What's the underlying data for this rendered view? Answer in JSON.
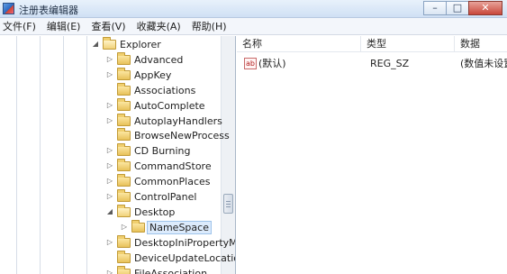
{
  "window": {
    "title": "注册表编辑器",
    "minimize_glyph": "–",
    "maximize_glyph": "□",
    "close_glyph": "✕"
  },
  "menu": [
    "文件(F)",
    "编辑(E)",
    "查看(V)",
    "收藏夹(A)",
    "帮助(H)"
  ],
  "tree": {
    "items": [
      {
        "label": "Explorer",
        "depth": 0,
        "state": "expanded",
        "folder_icon": "folder-open-icon"
      },
      {
        "label": "Advanced",
        "depth": 1,
        "state": "collapsed",
        "folder_icon": "folder-icon"
      },
      {
        "label": "AppKey",
        "depth": 1,
        "state": "collapsed",
        "folder_icon": "folder-icon"
      },
      {
        "label": "Associations",
        "depth": 1,
        "state": "none",
        "folder_icon": "folder-icon"
      },
      {
        "label": "AutoComplete",
        "depth": 1,
        "state": "collapsed",
        "folder_icon": "folder-icon"
      },
      {
        "label": "AutoplayHandlers",
        "depth": 1,
        "state": "collapsed",
        "folder_icon": "folder-icon"
      },
      {
        "label": "BrowseNewProcess",
        "depth": 1,
        "state": "none",
        "folder_icon": "folder-icon"
      },
      {
        "label": "CD Burning",
        "depth": 1,
        "state": "collapsed",
        "folder_icon": "folder-icon"
      },
      {
        "label": "CommandStore",
        "depth": 1,
        "state": "collapsed",
        "folder_icon": "folder-icon"
      },
      {
        "label": "CommonPlaces",
        "depth": 1,
        "state": "collapsed",
        "folder_icon": "folder-icon"
      },
      {
        "label": "ControlPanel",
        "depth": 1,
        "state": "collapsed",
        "folder_icon": "folder-icon"
      },
      {
        "label": "Desktop",
        "depth": 1,
        "state": "expanded",
        "folder_icon": "folder-open-icon"
      },
      {
        "label": "NameSpace",
        "depth": 2,
        "state": "collapsed",
        "folder_icon": "folder-icon",
        "selected": true
      },
      {
        "label": "DesktopIniPropertyM",
        "depth": 1,
        "state": "collapsed",
        "folder_icon": "folder-icon"
      },
      {
        "label": "DeviceUpdateLocatio",
        "depth": 1,
        "state": "none",
        "folder_icon": "folder-icon"
      },
      {
        "label": "FileAssociation",
        "depth": 1,
        "state": "collapsed",
        "folder_icon": "folder-icon"
      }
    ]
  },
  "list": {
    "columns": [
      "名称",
      "类型",
      "数据"
    ],
    "rows": [
      {
        "name": "(默认)",
        "type": "REG_SZ",
        "data": "(数值未设置",
        "icon": "reg-string-icon",
        "icon_text": "ab"
      }
    ]
  },
  "colors": {
    "selection_bg": "#dcebfc",
    "selection_border": "#9ec3ea",
    "folder": "#e8c25a"
  }
}
